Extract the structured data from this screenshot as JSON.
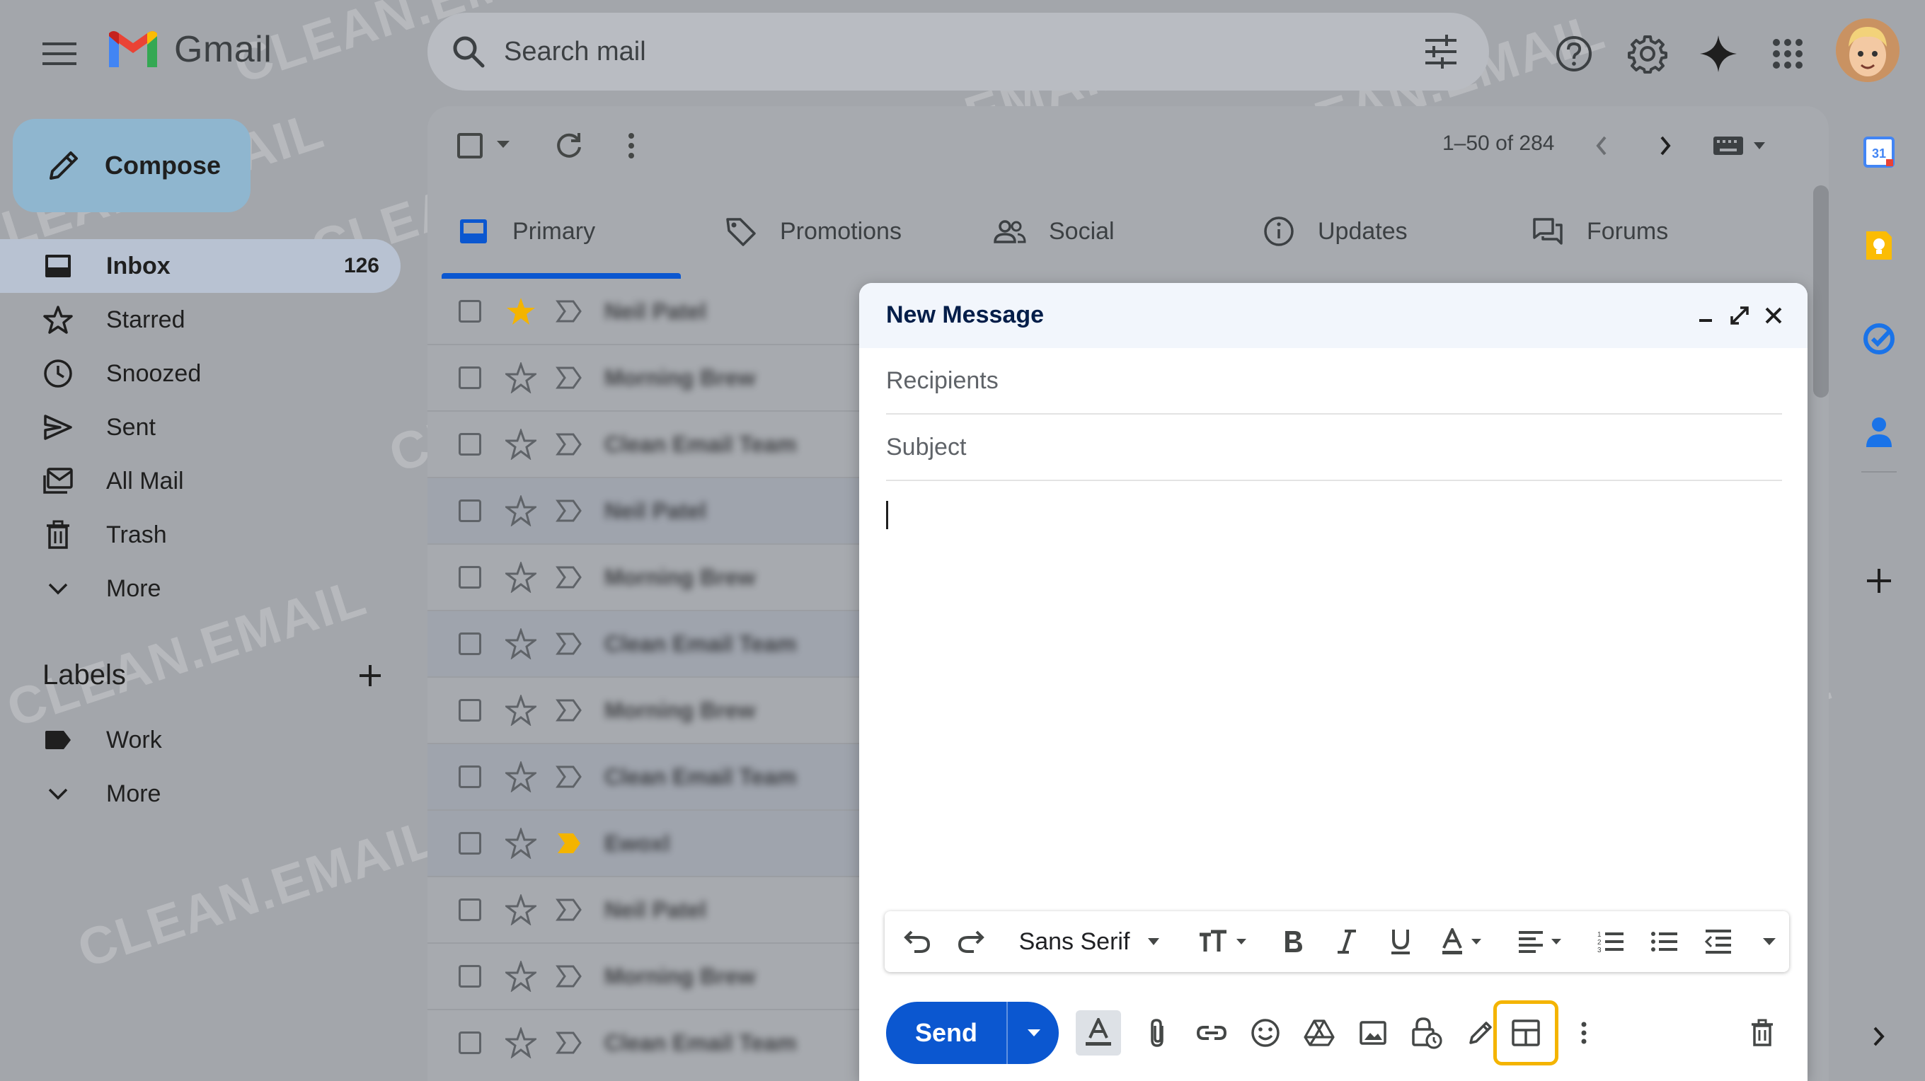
{
  "header": {
    "app_name": "Gmail",
    "search_placeholder": "Search mail"
  },
  "sidebar": {
    "compose_label": "Compose",
    "items": [
      {
        "label": "Inbox",
        "count": "126"
      },
      {
        "label": "Starred"
      },
      {
        "label": "Snoozed"
      },
      {
        "label": "Sent"
      },
      {
        "label": "All Mail"
      },
      {
        "label": "Trash"
      },
      {
        "label": "More"
      }
    ],
    "labels_title": "Labels",
    "labels": [
      {
        "label": "Work"
      },
      {
        "label": "More"
      }
    ]
  },
  "toolbar": {
    "pagination": "1–50 of 284"
  },
  "tabs": [
    {
      "label": "Primary"
    },
    {
      "label": "Promotions"
    },
    {
      "label": "Social"
    },
    {
      "label": "Updates"
    },
    {
      "label": "Forums"
    }
  ],
  "emails": [
    {
      "sender": "Neil Patel",
      "starred": true
    },
    {
      "sender": "Morning Brew",
      "starred": false
    },
    {
      "sender": "Clean Email Team",
      "starred": false
    },
    {
      "sender": "Neil Patel",
      "starred": false
    },
    {
      "sender": "Morning Brew",
      "starred": false
    },
    {
      "sender": "Clean Email Team",
      "starred": false
    },
    {
      "sender": "Morning Brew",
      "starred": false
    },
    {
      "sender": "Clean Email Team",
      "starred": false
    },
    {
      "sender": "Ewoxl",
      "starred": false
    },
    {
      "sender": "Neil Patel",
      "starred": false
    },
    {
      "sender": "Morning Brew",
      "starred": false
    },
    {
      "sender": "Clean Email Team",
      "starred": false
    }
  ],
  "compose_window": {
    "title": "New Message",
    "recipients_placeholder": "Recipients",
    "subject_placeholder": "Subject",
    "font": "Sans Serif",
    "send_label": "Send"
  },
  "colors": {
    "accent": "#0b57d0",
    "highlight": "#f4b400",
    "star": "#f4b400"
  },
  "watermark": "CLEAN.EMAIL"
}
